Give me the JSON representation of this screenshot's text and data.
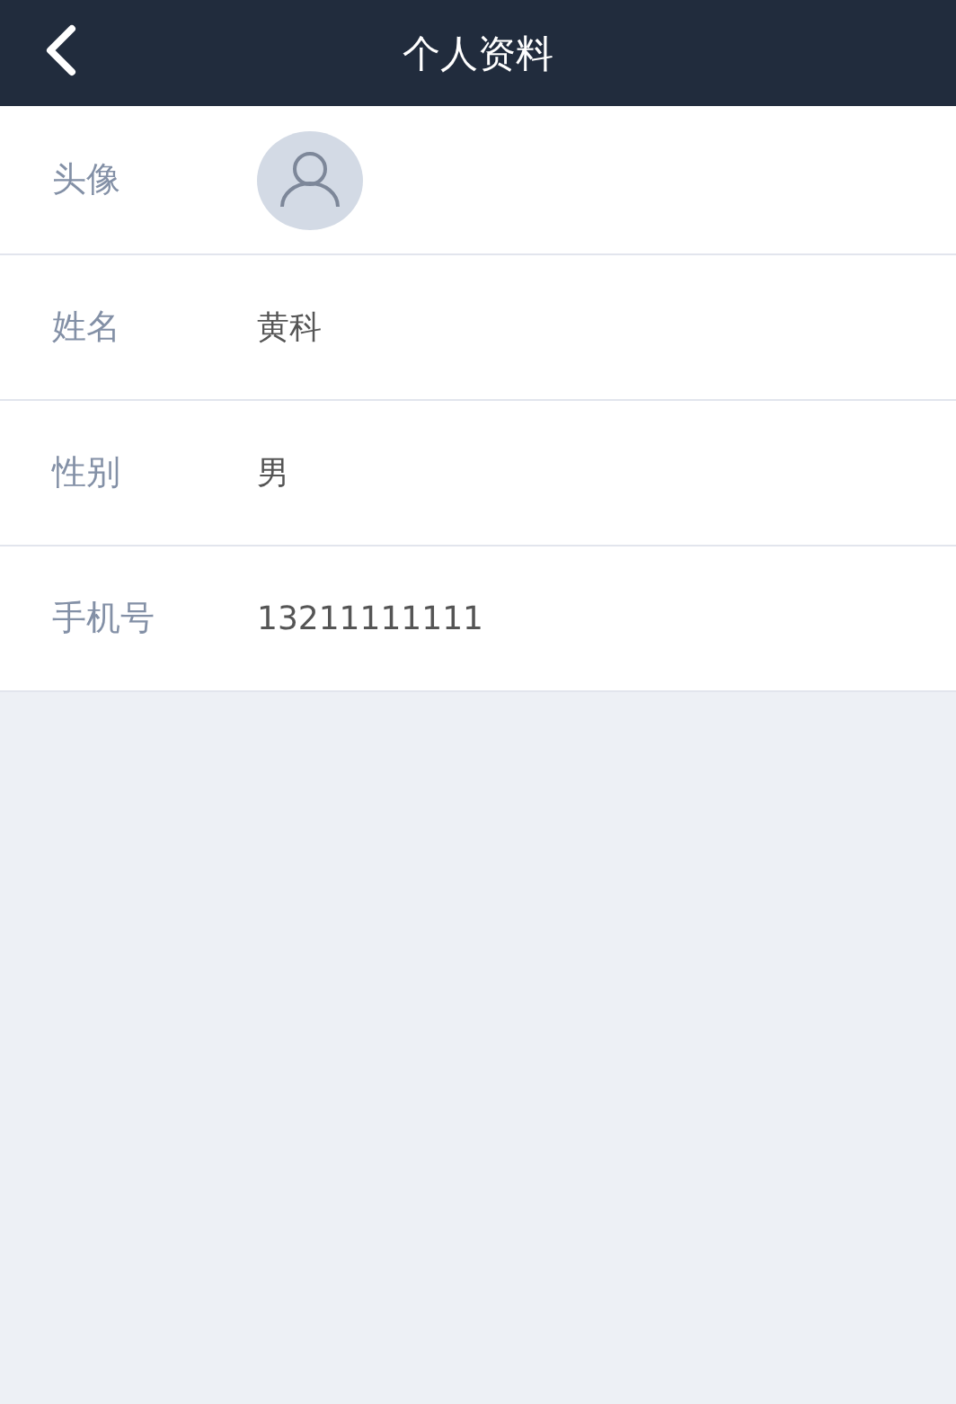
{
  "header": {
    "title": "个人资料"
  },
  "fields": [
    {
      "kind": "avatar",
      "label": "头像"
    },
    {
      "kind": "text",
      "label": "姓名",
      "value": "黄科"
    },
    {
      "kind": "text",
      "label": "性别",
      "value": "男"
    },
    {
      "kind": "text",
      "label": "手机号",
      "value": "13211111111"
    }
  ]
}
